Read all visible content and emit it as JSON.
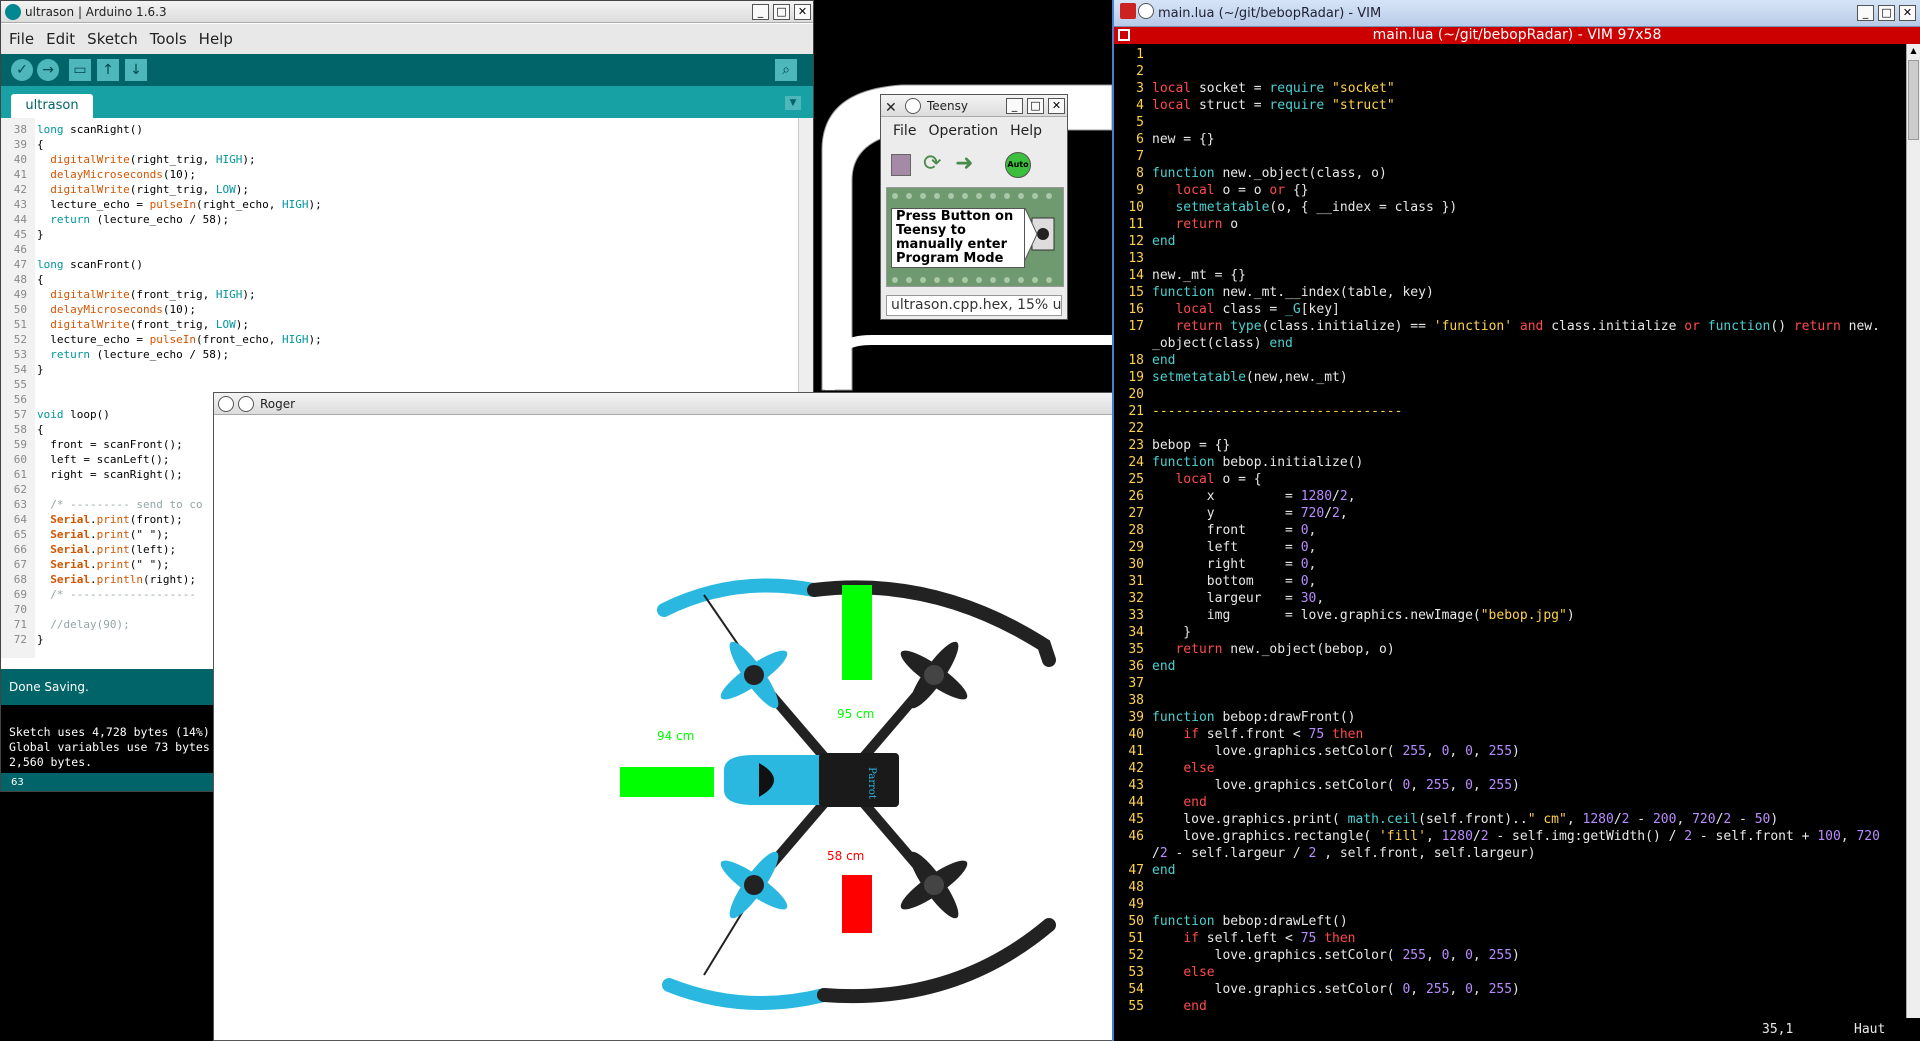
{
  "arduino": {
    "title": "ultrason | Arduino 1.6.3",
    "menu": [
      "File",
      "Edit",
      "Sketch",
      "Tools",
      "Help"
    ],
    "tab": "ultrason",
    "code": [
      {
        "ln": "38",
        "t": "long scanRight()"
      },
      {
        "ln": "39",
        "t": "{"
      },
      {
        "ln": "40",
        "t": "  digitalWrite(right_trig, HIGH);"
      },
      {
        "ln": "41",
        "t": "  delayMicroseconds(10);"
      },
      {
        "ln": "42",
        "t": "  digitalWrite(right_trig, LOW);"
      },
      {
        "ln": "43",
        "t": "  lecture_echo = pulseIn(right_echo, HIGH);"
      },
      {
        "ln": "44",
        "t": "  return (lecture_echo / 58);"
      },
      {
        "ln": "45",
        "t": "}"
      },
      {
        "ln": "46",
        "t": ""
      },
      {
        "ln": "47",
        "t": "long scanFront()"
      },
      {
        "ln": "48",
        "t": "{"
      },
      {
        "ln": "49",
        "t": "  digitalWrite(front_trig, HIGH);"
      },
      {
        "ln": "50",
        "t": "  delayMicroseconds(10);"
      },
      {
        "ln": "51",
        "t": "  digitalWrite(front_trig, LOW);"
      },
      {
        "ln": "52",
        "t": "  lecture_echo = pulseIn(front_echo, HIGH);"
      },
      {
        "ln": "53",
        "t": "  return (lecture_echo / 58);"
      },
      {
        "ln": "54",
        "t": "}"
      },
      {
        "ln": "55",
        "t": ""
      },
      {
        "ln": "56",
        "t": ""
      },
      {
        "ln": "57",
        "t": "void loop()"
      },
      {
        "ln": "58",
        "t": "{"
      },
      {
        "ln": "59",
        "t": "  front = scanFront();"
      },
      {
        "ln": "60",
        "t": "  left = scanLeft();"
      },
      {
        "ln": "61",
        "t": "  right = scanRight();"
      },
      {
        "ln": "62",
        "t": ""
      },
      {
        "ln": "63",
        "t": "  /* --------- send to co"
      },
      {
        "ln": "64",
        "t": "  Serial.print(front);"
      },
      {
        "ln": "65",
        "t": "  Serial.print(\" \");"
      },
      {
        "ln": "66",
        "t": "  Serial.print(left);"
      },
      {
        "ln": "67",
        "t": "  Serial.print(\" \");"
      },
      {
        "ln": "68",
        "t": "  Serial.println(right);"
      },
      {
        "ln": "69",
        "t": "  /* -------------------"
      },
      {
        "ln": "70",
        "t": ""
      },
      {
        "ln": "71",
        "t": "  //delay(90);"
      },
      {
        "ln": "72",
        "t": "}"
      }
    ],
    "status": "Done Saving.",
    "console": [
      "Sketch uses 4,728 bytes (14%)",
      "Global variables use 73 bytes",
      "2,560 bytes."
    ],
    "line_number": "63"
  },
  "teensy": {
    "title": "Teensy",
    "menu": [
      "File",
      "Operation",
      "Help"
    ],
    "auto_label": "Auto",
    "note": "Press Button on Teensy to manually enter Program Mode",
    "status": "ultrason.cpp.hex, 15% u"
  },
  "roger": {
    "title": "Roger",
    "readings": {
      "front": "95 cm",
      "left": "94 cm",
      "right": "58 cm"
    },
    "brand": "Parrot",
    "colors": {
      "front_bar": "#00ff00",
      "left_bar": "#00ff00",
      "right_bar": "#ff0000",
      "text": "#00ff00",
      "right_text": "#ff0000"
    }
  },
  "vim": {
    "window_title": "main.lua (~/git/bebopRadar) - VIM",
    "bar_title": "main.lua (~/git/bebopRadar) - VIM 97x58",
    "lines": [
      {
        "ln": "1",
        "h": ""
      },
      {
        "ln": "2",
        "h": ""
      },
      {
        "ln": "3",
        "h": "<span class='v-kw'>local</span> socket = <span class='v-fn'>require</span> <span class='v-str'>\"socket\"</span>"
      },
      {
        "ln": "4",
        "h": "<span class='v-kw'>local</span> struct = <span class='v-fn'>require</span> <span class='v-str'>\"struct\"</span>"
      },
      {
        "ln": "5",
        "h": ""
      },
      {
        "ln": "6",
        "h": "new = {}"
      },
      {
        "ln": "7",
        "h": ""
      },
      {
        "ln": "8",
        "h": "<span class='v-fn'>function</span> new._object(class, o)"
      },
      {
        "ln": "9",
        "h": "   <span class='v-kw'>local</span> o = o <span class='v-kw'>or</span> {}"
      },
      {
        "ln": "10",
        "h": "   <span class='v-fn'>setmetatable</span>(o, { __index = class })"
      },
      {
        "ln": "11",
        "h": "   <span class='v-kw'>return</span> o"
      },
      {
        "ln": "12",
        "h": "<span class='v-fn'>end</span>"
      },
      {
        "ln": "13",
        "h": ""
      },
      {
        "ln": "14",
        "h": "new._mt = {}"
      },
      {
        "ln": "15",
        "h": "<span class='v-fn'>function</span> new._mt.__index(table, key)"
      },
      {
        "ln": "16",
        "h": "   <span class='v-kw'>local</span> class = <span class='v-fn'>_G</span>[key]"
      },
      {
        "ln": "17",
        "h": "   <span class='v-kw'>return</span> <span class='v-fn'>type</span>(class.initialize) == <span class='v-str'>'function'</span> <span class='v-kw'>and</span> class.initialize <span class='v-kw'>or</span> <span class='v-fn'>function</span>() <span class='v-kw'>return</span> new."
      },
      {
        "ln": "",
        "h": "_object(class) <span class='v-fn'>end</span>"
      },
      {
        "ln": "18",
        "h": "<span class='v-fn'>end</span>"
      },
      {
        "ln": "19",
        "h": "<span class='v-fn'>setmetatable</span>(new,new._mt)"
      },
      {
        "ln": "20",
        "h": ""
      },
      {
        "ln": "21",
        "h": "<span class='v-str'>--------------------------------</span>"
      },
      {
        "ln": "22",
        "h": ""
      },
      {
        "ln": "23",
        "h": "bebop = {}"
      },
      {
        "ln": "24",
        "h": "<span class='v-fn'>function</span> bebop.initialize()"
      },
      {
        "ln": "25",
        "h": "   <span class='v-kw'>local</span> o = {"
      },
      {
        "ln": "26",
        "h": "       x         = <span class='v-num'>1280</span>/<span class='v-num'>2</span>,"
      },
      {
        "ln": "27",
        "h": "       y         = <span class='v-num'>720</span>/<span class='v-num'>2</span>,"
      },
      {
        "ln": "28",
        "h": "       front     = <span class='v-num'>0</span>,"
      },
      {
        "ln": "29",
        "h": "       left      = <span class='v-num'>0</span>,"
      },
      {
        "ln": "30",
        "h": "       right     = <span class='v-num'>0</span>,"
      },
      {
        "ln": "31",
        "h": "       bottom    = <span class='v-num'>0</span>,"
      },
      {
        "ln": "32",
        "h": "       largeur   = <span class='v-num'>30</span>,"
      },
      {
        "ln": "33",
        "h": "       img       = love.graphics.newImage(<span class='v-str'>\"bebop.jpg\"</span>)"
      },
      {
        "ln": "34",
        "h": "    }"
      },
      {
        "ln": "35",
        "h": "   <span class='v-kw'>return</span> new._object(bebop, o)"
      },
      {
        "ln": "36",
        "h": "<span class='v-fn'>end</span>"
      },
      {
        "ln": "37",
        "h": ""
      },
      {
        "ln": "38",
        "h": ""
      },
      {
        "ln": "39",
        "h": "<span class='v-fn'>function</span> bebop:drawFront()"
      },
      {
        "ln": "40",
        "h": "    <span class='v-kw'>if</span> self.front &lt; <span class='v-num'>75</span> <span class='v-kw'>then</span>"
      },
      {
        "ln": "41",
        "h": "        love.graphics.setColor( <span class='v-num'>255</span>, <span class='v-num'>0</span>, <span class='v-num'>0</span>, <span class='v-num'>255</span>)"
      },
      {
        "ln": "42",
        "h": "    <span class='v-kw'>else</span>"
      },
      {
        "ln": "43",
        "h": "        love.graphics.setColor( <span class='v-num'>0</span>, <span class='v-num'>255</span>, <span class='v-num'>0</span>, <span class='v-num'>255</span>)"
      },
      {
        "ln": "44",
        "h": "    <span class='v-kw'>end</span>"
      },
      {
        "ln": "45",
        "h": "    love.graphics.print( <span class='v-fn'>math.ceil</span>(self.front)..<span class='v-str'>\" cm\"</span>, <span class='v-num'>1280</span>/<span class='v-num'>2</span> - <span class='v-num'>200</span>, <span class='v-num'>720</span>/<span class='v-num'>2</span> - <span class='v-num'>50</span>)"
      },
      {
        "ln": "46",
        "h": "    love.graphics.rectangle( <span class='v-str'>'fill'</span>, <span class='v-num'>1280</span>/<span class='v-num'>2</span> - self.img:getWidth() / <span class='v-num'>2</span> - self.front + <span class='v-num'>100</span>, <span class='v-num'>720</span>"
      },
      {
        "ln": "",
        "h": "/<span class='v-num'>2</span> - self.largeur / <span class='v-num'>2</span> , self.front, self.largeur)"
      },
      {
        "ln": "47",
        "h": "<span class='v-fn'>end</span>"
      },
      {
        "ln": "48",
        "h": ""
      },
      {
        "ln": "49",
        "h": ""
      },
      {
        "ln": "50",
        "h": "<span class='v-fn'>function</span> bebop:drawLeft()"
      },
      {
        "ln": "51",
        "h": "    <span class='v-kw'>if</span> self.left &lt; <span class='v-num'>75</span> <span class='v-kw'>then</span>"
      },
      {
        "ln": "52",
        "h": "        love.graphics.setColor( <span class='v-num'>255</span>, <span class='v-num'>0</span>, <span class='v-num'>0</span>, <span class='v-num'>255</span>)"
      },
      {
        "ln": "53",
        "h": "    <span class='v-kw'>else</span>"
      },
      {
        "ln": "54",
        "h": "        love.graphics.setColor( <span class='v-num'>0</span>, <span class='v-num'>255</span>, <span class='v-num'>0</span>, <span class='v-num'>255</span>)"
      },
      {
        "ln": "55",
        "h": "    <span class='v-kw'>end</span>"
      }
    ],
    "cursor_pos": "35,1",
    "scroll_pos": "Haut"
  }
}
